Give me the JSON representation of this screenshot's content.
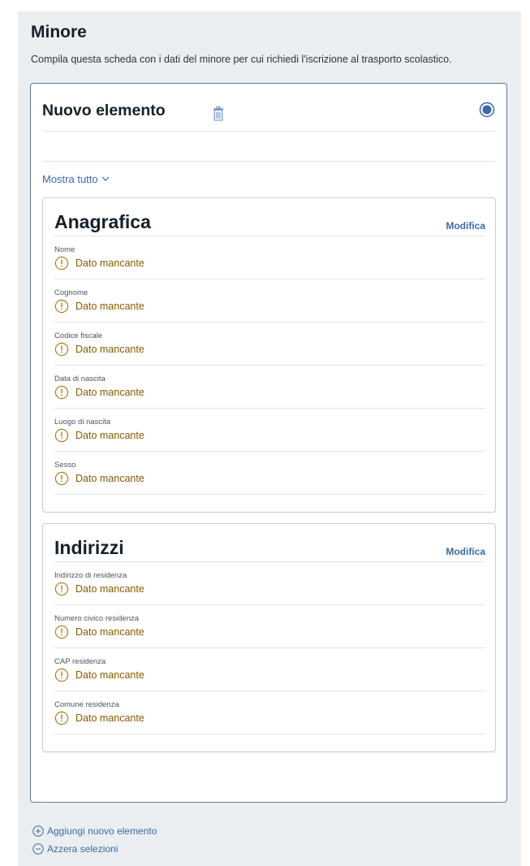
{
  "section": {
    "title": "Minore",
    "description": "Compila questa scheda con i dati del minore per cui richiedi l'iscrizione al trasporto scolastico."
  },
  "card": {
    "title": "Nuovo elemento",
    "show_all": "Mostra tutto",
    "panels": [
      {
        "title": "Anagrafica",
        "edit_label": "Modifica",
        "fields": [
          {
            "label": "Nome",
            "value": "Dato mancante"
          },
          {
            "label": "Cognome",
            "value": "Dato mancante"
          },
          {
            "label": "Codice fiscale",
            "value": "Dato mancante"
          },
          {
            "label": "Data di nascita",
            "value": "Dato mancante"
          },
          {
            "label": "Luogo di nascita",
            "value": "Dato mancante"
          },
          {
            "label": "Sesso",
            "value": "Dato mancante"
          }
        ]
      },
      {
        "title": "Indirizzi",
        "edit_label": "Modifica",
        "fields": [
          {
            "label": "Indirizzo di residenza",
            "value": "Dato mancante"
          },
          {
            "label": "Numero civico residenza",
            "value": "Dato mancante"
          },
          {
            "label": "CAP residenza",
            "value": "Dato mancante"
          },
          {
            "label": "Comune residenza",
            "value": "Dato mancante"
          }
        ]
      }
    ]
  },
  "actions": {
    "add_label": "Aggiungi nuovo elemento",
    "reset_label": "Azzera selezioni"
  },
  "colors": {
    "accent": "#3e6aa8",
    "warning": "#8a5a00",
    "background": "#ebeef1"
  },
  "icons": {
    "delete": "trash-icon",
    "select": "radio-selected-icon",
    "missing": "warning-circle-icon",
    "expand": "chevron-down-icon",
    "add": "plus-circle-icon",
    "reset": "minus-circle-icon"
  }
}
